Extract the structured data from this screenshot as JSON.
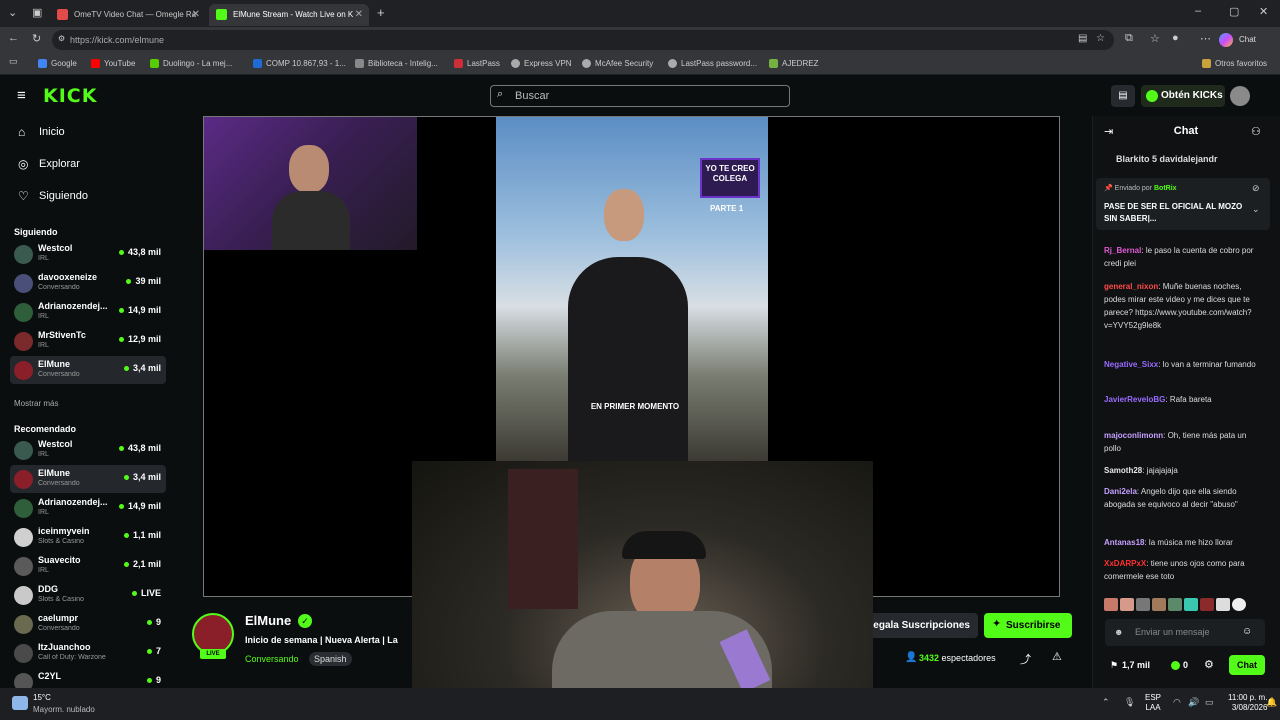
{
  "browser": {
    "tabs": [
      {
        "title": "OmeTV Video Chat — Omegle Ra",
        "color": "#e34b4b"
      },
      {
        "title": "ElMune Stream - Watch Live on K",
        "color": "#53fc18"
      }
    ],
    "url": "https://kick.com/elmune",
    "profile_label": "Chat",
    "bookmarks": [
      {
        "label": "Google",
        "color": "#4285f4"
      },
      {
        "label": "YouTube",
        "color": "#ff0000"
      },
      {
        "label": "Duolingo - La mej...",
        "color": "#58cc02"
      },
      {
        "label": "COMP 10.867,93 - 1...",
        "color": "#1e6bd6"
      },
      {
        "label": "Biblioteca - Intelig...",
        "color": "#888888"
      },
      {
        "label": "LastPass",
        "color": "#cc2e3a"
      },
      {
        "label": "Express VPN",
        "color": "#aaaaaa"
      },
      {
        "label": "McAfee Security",
        "color": "#aaaaaa"
      },
      {
        "label": "LastPass password...",
        "color": "#aaaaaa"
      },
      {
        "label": "AJEDREZ",
        "color": "#76b041"
      }
    ],
    "other_bookmarks": "Otros favoritos"
  },
  "header": {
    "logo": "KICK",
    "search_placeholder": "Buscar",
    "get_kicks": "Obtén KICKs"
  },
  "sidebar": {
    "nav": [
      {
        "label": "Inicio",
        "icon": "⌂"
      },
      {
        "label": "Explorar",
        "icon": "◎"
      },
      {
        "label": "Siguiendo",
        "icon": "♡"
      }
    ],
    "following_title": "Siguiendo",
    "following": [
      {
        "name": "Westcol",
        "category": "IRL",
        "viewers": "43,8 mil",
        "color": "#3a5a50"
      },
      {
        "name": "davooxeneize",
        "category": "Conversando",
        "viewers": "39 mil",
        "color": "#4a4f7a"
      },
      {
        "name": "Adrianozendej...",
        "category": "IRL",
        "viewers": "14,9 mil",
        "color": "#2f5e3a"
      },
      {
        "name": "MrStivenTc",
        "category": "IRL",
        "viewers": "12,9 mil",
        "color": "#7a2a2a"
      },
      {
        "name": "ElMune",
        "category": "Conversando",
        "viewers": "3,4 mil",
        "color": "#8a1f2a"
      }
    ],
    "show_more": "Mostrar más",
    "recommended_title": "Recomendado",
    "recommended": [
      {
        "name": "Westcol",
        "category": "IRL",
        "viewers": "43,8 mil",
        "color": "#3a5a50"
      },
      {
        "name": "ElMune",
        "category": "Conversando",
        "viewers": "3,4 mil",
        "color": "#8a1f2a"
      },
      {
        "name": "Adrianozendej...",
        "category": "IRL",
        "viewers": "14,9 mil",
        "color": "#2f5e3a"
      },
      {
        "name": "iceinmyvein",
        "category": "Slots & Casino",
        "viewers": "1,1 mil",
        "color": "#d0d0d0"
      },
      {
        "name": "Suavecito",
        "category": "IRL",
        "viewers": "2,1 mil",
        "color": "#5a5a5a"
      },
      {
        "name": "DDG",
        "category": "Slots & Casino",
        "viewers": "LIVE",
        "color": "#c9c9c9"
      },
      {
        "name": "caelumpr",
        "category": "Conversando",
        "viewers": "9",
        "color": "#6a6a50"
      },
      {
        "name": "ItzJuanchoo",
        "category": "Call of Duty: Warzone",
        "viewers": "7",
        "color": "#4a4a4a"
      },
      {
        "name": "C2YL",
        "category": "",
        "viewers": "9",
        "color": "#555555"
      }
    ]
  },
  "video": {
    "overlay_tag": "YO TE CREO COLEGA",
    "overlay_part": "PARTE 1",
    "subtitle": "EN PRIMER MOMENTO"
  },
  "stream": {
    "name": "ElMune",
    "title": "Inicio de semana | Nueva Alerta | La",
    "category": "Conversando",
    "language": "Spanish",
    "live_badge": "LIVE",
    "gift_button": "Regala Suscripciones",
    "subscribe_button": "Suscribirse",
    "viewers_count": "3432",
    "viewers_label": "espectadores"
  },
  "chat": {
    "title": "Chat",
    "top_gifters": "Blarkito 5   davidalejandr",
    "pinned_by": "Enviado por",
    "pinned_user": "BotRix",
    "pinned_text": "PASE DE SER EL OFICIAL AL MOZO SIN SABER|...",
    "messages": [
      {
        "user": "Rj_Bernal",
        "color": "#e05ad5",
        "text": "le paso la cuenta de cobro por credi plei"
      },
      {
        "user": "general_nixon",
        "color": "#ff4a4a",
        "text": "Muñe buenas noches, podes mirar este video y me dices que te parece? https://www.youtube.com/watch?v=YVY52g9le8k"
      },
      {
        "user": "Negative_Sixx",
        "color": "#9a6bff",
        "text": "lo van a terminar fumando"
      },
      {
        "user": "JavierReveloBG",
        "color": "#9a6bff",
        "text": "Rafa bareta"
      },
      {
        "user": "majoconlimonn",
        "color": "#c6a0ff",
        "text": "Oh, tiene más pata un pollo"
      },
      {
        "user": "Samoth28",
        "color": "#e8e8e8",
        "text": "jajajajaja"
      },
      {
        "user": "Dani2ela",
        "color": "#c6a0ff",
        "text": "Angelo dijo que ella siendo abogada se equivoco al decir \"abuso\""
      },
      {
        "user": "Antanas18",
        "color": "#c6a0ff",
        "text": "la música me hizo llorar"
      },
      {
        "user": "XxDARPxX",
        "color": "#ff3030",
        "text": "tiene unos ojos como para comermele ese toto"
      }
    ],
    "input_placeholder": "Enviar un mensaje",
    "points": "1,7 mil",
    "kicks": "0",
    "send_button": "Chat"
  },
  "taskbar": {
    "temp": "15°C",
    "weather": "Mayorm. nublado",
    "lang": "ESP",
    "region": "LAA",
    "time": "11:00 p. m.",
    "date": "3/08/2026"
  }
}
